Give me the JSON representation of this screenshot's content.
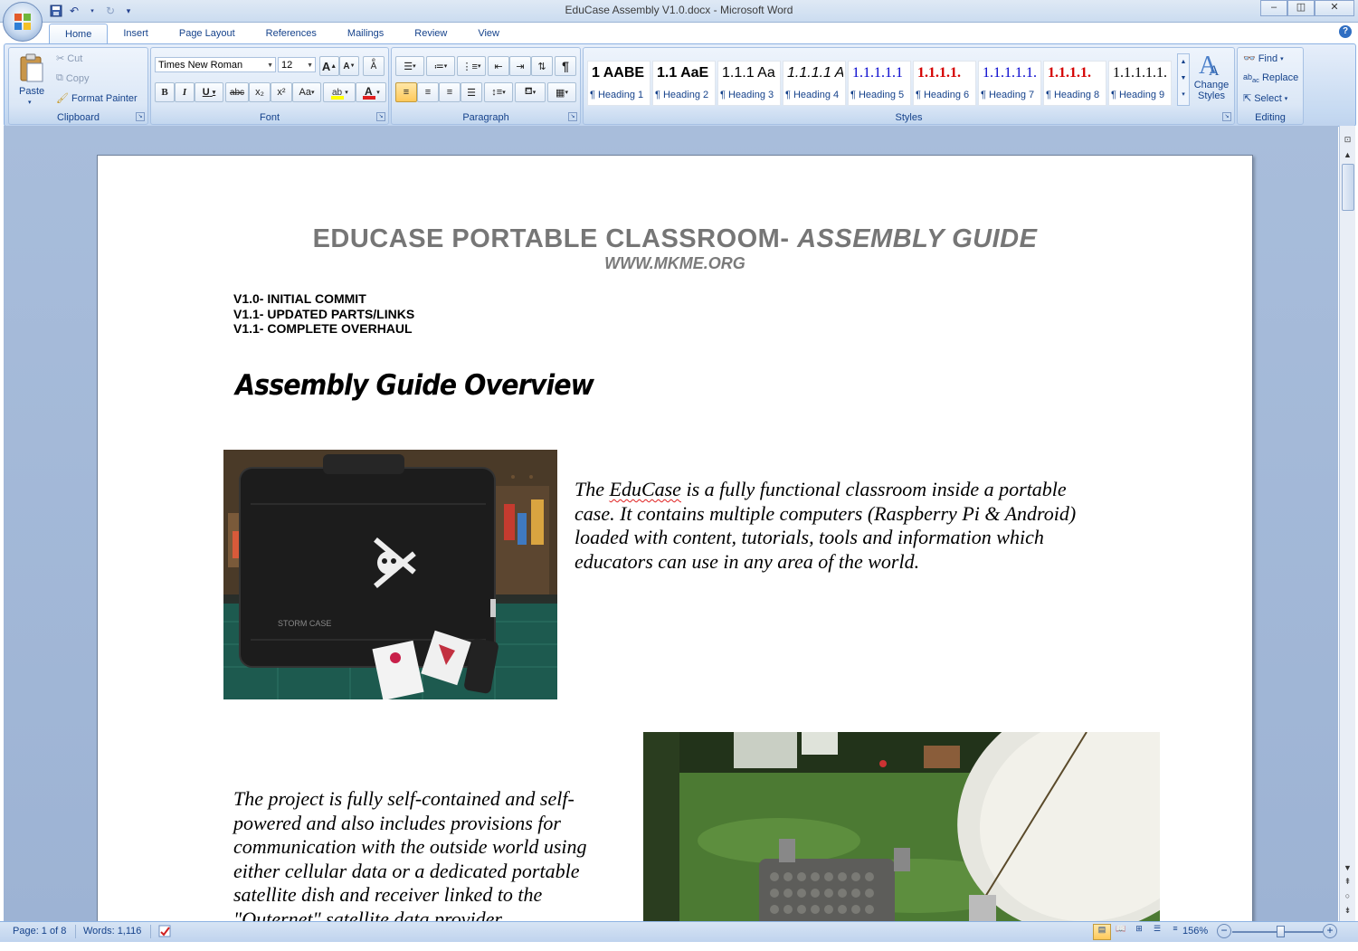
{
  "window": {
    "title": "EduCase Assembly V1.0.docx - Microsoft Word",
    "minimize": "▭",
    "restore": "◫",
    "close": "✕"
  },
  "qat": {
    "save_icon": "save-icon",
    "undo_icon": "undo-icon",
    "redo_icon": "redo-icon",
    "customize": "▾"
  },
  "tabs": [
    "Home",
    "Insert",
    "Page Layout",
    "References",
    "Mailings",
    "Review",
    "View"
  ],
  "active_tab": "Home",
  "clipboard": {
    "paste": "Paste",
    "cut": "Cut",
    "copy": "Copy",
    "format_painter": "Format Painter",
    "label": "Clipboard"
  },
  "font": {
    "family": "Times New Roman",
    "size": "12",
    "label": "Font",
    "bold": "B",
    "italic": "I",
    "underline": "U",
    "strike": "abc",
    "subscript": "x₂",
    "superscript": "x²",
    "change_case": "Aa",
    "grow": "A",
    "shrink": "A",
    "highlight_color": "#ffff00",
    "font_color": "#e02020"
  },
  "paragraph": {
    "label": "Paragraph",
    "pilcrow": "¶"
  },
  "styles": {
    "label": "Styles",
    "change_styles": "Change Styles",
    "items": [
      {
        "sample": "1  AABE",
        "name": "¶ Heading 1",
        "color": "#000000"
      },
      {
        "sample": "1.1  AaE",
        "name": "¶ Heading 2",
        "color": "#000000"
      },
      {
        "sample": "1.1.1  Aa",
        "name": "¶ Heading 3",
        "color": "#000000"
      },
      {
        "sample": "1.1.1.1  A",
        "name": "¶ Heading 4",
        "color": "#000000"
      },
      {
        "sample": "1.1.1.1.1",
        "name": "¶ Heading 5",
        "color": "#0000cc"
      },
      {
        "sample": "1.1.1.1.",
        "name": "¶ Heading 6",
        "color": "#d40000"
      },
      {
        "sample": "1.1.1.1.1.",
        "name": "¶ Heading 7",
        "color": "#0000cc"
      },
      {
        "sample": "1.1.1.1.",
        "name": "¶ Heading 8",
        "color": "#d40000"
      },
      {
        "sample": "1.1.1.1.1.",
        "name": "¶ Heading 9",
        "color": "#000000"
      }
    ]
  },
  "editing": {
    "label": "Editing",
    "find": "Find",
    "replace": "Replace",
    "select": "Select"
  },
  "document": {
    "title_plain": "EDUCASE PORTABLE CLASSROOM- ",
    "title_italic": "ASSEMBLY GUIDE",
    "url": "WWW.MKME.ORG",
    "versions": [
      "V1.0- INITIAL COMMIT",
      "V1.1- UPDATED PARTS/LINKS",
      "V1.1- COMPLETE OVERHAUL"
    ],
    "heading": "Assembly Guide Overview",
    "para1_pre": "The ",
    "para1_word": "EduCase",
    "para1_post": " is a fully functional classroom inside a portable case. It contains multiple computers (Raspberry Pi & Android) loaded with content, tutorials, tools and information which educators can use in any area of the world.",
    "para2": "The project is fully self-contained and self-powered and also includes provisions for communication with the outside world using either cellular data or a dedicated portable satellite dish and receiver  linked to the \"Outernet\" satellite data provider.",
    "image1_alt": "Black hard case with skull-and-crossbones sticker, Raspberry Pi box and keyboard",
    "image2_alt": "Portable satellite dish next to a case on a lawn",
    "case_brand": "STORM CASE"
  },
  "status": {
    "page": "Page: 1 of 8",
    "words": "Words: 1,116",
    "zoom": "156%"
  }
}
